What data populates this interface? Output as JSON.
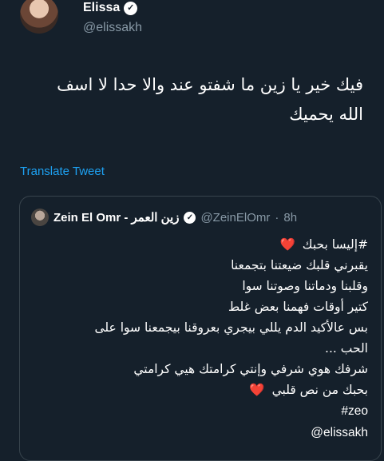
{
  "tweet": {
    "author_name": "Elissa",
    "author_handle": "@elissakh",
    "text_line1": "فيك خير يا زين ما شفتو عند والا حدا لا اسف",
    "text_line2": "الله يحميك",
    "translate_label": "Translate Tweet"
  },
  "quoted_tweet": {
    "author_name": "Zein El Omr - زين العمر",
    "author_handle": "@ZeinElOmr",
    "separator": "·",
    "time": "8h",
    "lines": [
      "#إليسا بحبك",
      "يقبرني قلبك ضيعتنا بتجمعنا",
      "وقلبنا ودماتنا وصوتنا سوا",
      "كتير أوقات فهمنا بعض غلط",
      "بس عالأكيد الدم يللي بيجري بعروقنا بيجمعنا سوا على",
      "الحب ...",
      "شرفك هوي شرفي وإنتي كرامتك هيي كرامتي",
      "بحبك من نص قلبي",
      "#zeo",
      "@elissakh"
    ],
    "heart_glyph": "❤️"
  },
  "icons": {
    "verified": "check-icon",
    "heart": "heart-icon"
  },
  "colors": {
    "background": "#15202b",
    "link": "#1da1f2",
    "muted": "#8899a6",
    "border": "#38444d",
    "heart": "#e0245e"
  }
}
